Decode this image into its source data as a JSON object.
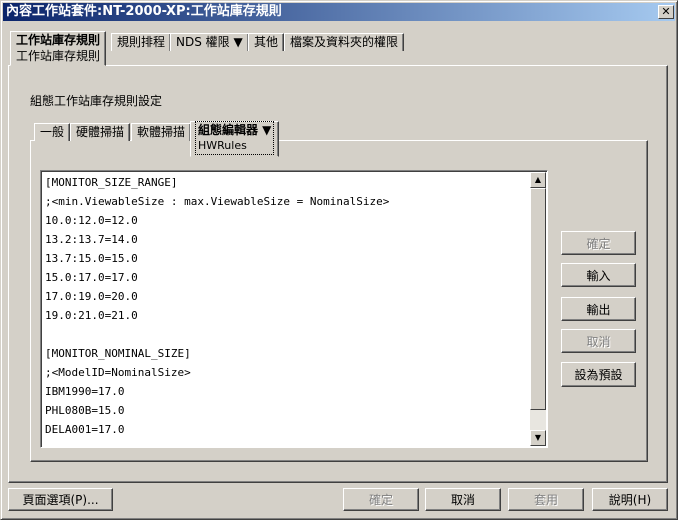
{
  "window": {
    "title": "內容工作站套件:NT-2000-XP:工作站庫存規則",
    "close": "✕"
  },
  "tabs": [
    {
      "label": "工作站庫存規則",
      "sub": "工作站庫存規則"
    },
    {
      "label": "規則排程"
    },
    {
      "label": "NDS 權限 ▼"
    },
    {
      "label": "其他"
    },
    {
      "label": "檔案及資料夾的權限"
    }
  ],
  "section_label": "組態工作站庫存規則設定",
  "inner_tabs": [
    {
      "label": "一般"
    },
    {
      "label": "硬體掃描"
    },
    {
      "label": "軟體掃描"
    },
    {
      "label": "組態編輯器 ▼",
      "sub": "HWRules"
    }
  ],
  "editor_lines": [
    "[MONITOR_SIZE_RANGE]",
    ";<min.ViewableSize : max.ViewableSize = NominalSize>",
    "10.0:12.0=12.0",
    "13.2:13.7=14.0",
    "13.7:15.0=15.0",
    "15.0:17.0=17.0",
    "17.0:19.0=20.0",
    "19.0:21.0=21.0",
    "",
    "[MONITOR_NOMINAL_SIZE]",
    ";<ModelID=NominalSize>",
    "IBM1990=17.0",
    "PHL080B=15.0",
    "DELA001=17.0"
  ],
  "side_buttons": {
    "ok": "確定",
    "import": "輸入",
    "export": "輸出",
    "cancel": "取消",
    "default": "設為預設"
  },
  "footer": {
    "page_options": "頁面選項(P)...",
    "ok": "確定",
    "cancel": "取消",
    "apply": "套用",
    "help": "說明(H)"
  }
}
